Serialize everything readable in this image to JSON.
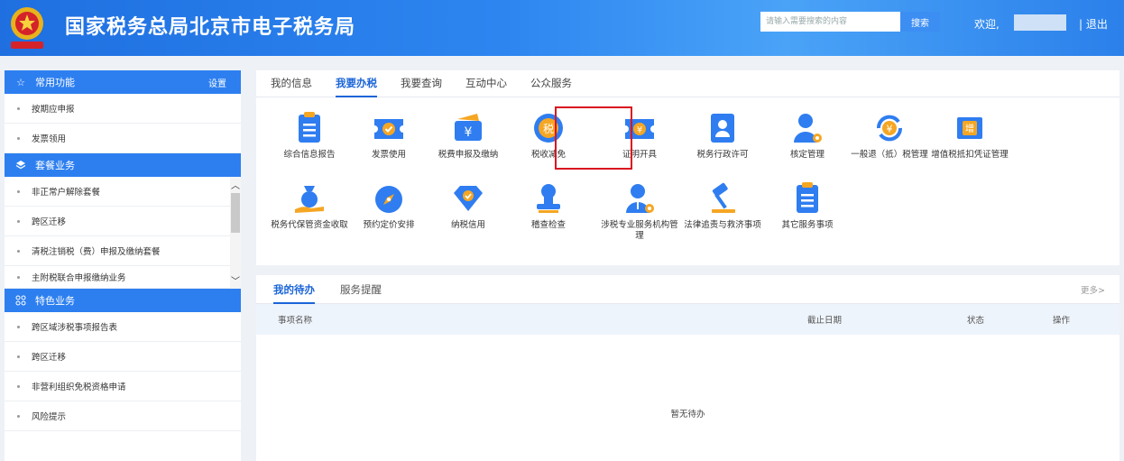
{
  "header": {
    "title": "国家税务总局北京市电子税务局",
    "search_placeholder": "请输入需要搜索的内容",
    "search_button": "搜索",
    "welcome": "欢迎,",
    "logout": "| 退出"
  },
  "sidebar": {
    "sections": [
      {
        "title": "常用功能",
        "icon": "star-icon",
        "action": "设置",
        "items": [
          "按期应申报",
          "发票领用"
        ]
      },
      {
        "title": "套餐业务",
        "icon": "layers-icon",
        "items": [
          "非正常户解除套餐",
          "跨区迁移",
          "清税注销税（费）申报及缴纳套餐",
          "主附税联合申报缴纳业务"
        ]
      },
      {
        "title": "特色业务",
        "icon": "grid-icon",
        "items": [
          "跨区域涉税事项报告表",
          "跨区迁移",
          "非营利组织免税资格申请",
          "风险提示"
        ]
      }
    ]
  },
  "main_tabs": {
    "items": [
      "我的信息",
      "我要办税",
      "我要查询",
      "互动中心",
      "公众服务"
    ],
    "active": "我要办税"
  },
  "services": [
    {
      "label": "综合信息报告",
      "icon": "clipboard-icon"
    },
    {
      "label": "发票使用",
      "icon": "invoice-ticket-icon"
    },
    {
      "label": "税费申报及缴纳",
      "icon": "yuan-wallet-icon"
    },
    {
      "label": "税收减免",
      "icon": "tax-coin-icon"
    },
    {
      "label": "证明开具",
      "icon": "yuan-ticket-icon"
    },
    {
      "label": "税务行政许可",
      "icon": "id-badge-icon"
    },
    {
      "label": "核定管理",
      "icon": "user-gear-icon"
    },
    {
      "label": "一般退（抵）税管理",
      "icon": "yuan-refresh-icon"
    },
    {
      "label": "增值税抵扣凭证管理",
      "icon": "vat-ticket-icon"
    },
    {
      "label": "税务代保管资金收取",
      "icon": "money-bag-hand-icon"
    },
    {
      "label": "预约定价安排",
      "icon": "compass-icon"
    },
    {
      "label": "纳税信用",
      "icon": "diamond-check-icon"
    },
    {
      "label": "稽查检查",
      "icon": "stamp-icon"
    },
    {
      "label": "涉税专业服务机构管理",
      "icon": "user-info-gear-icon"
    },
    {
      "label": "法律追责与救济事项",
      "icon": "gavel-icon"
    },
    {
      "label": "其它服务事项",
      "icon": "list-icon"
    }
  ],
  "todo": {
    "tabs": [
      "我的待办",
      "服务提醒"
    ],
    "active": "我的待办",
    "more": "更多>",
    "columns": [
      "事项名称",
      "截止日期",
      "状态",
      "操作"
    ],
    "empty_text": "暂无待办"
  },
  "colors": {
    "header_blue": "#2d86f0",
    "accent_blue": "#1a64d8",
    "highlight_red": "#d9151f",
    "icon_blue": "#2f7df0",
    "icon_orange": "#f5a623"
  }
}
